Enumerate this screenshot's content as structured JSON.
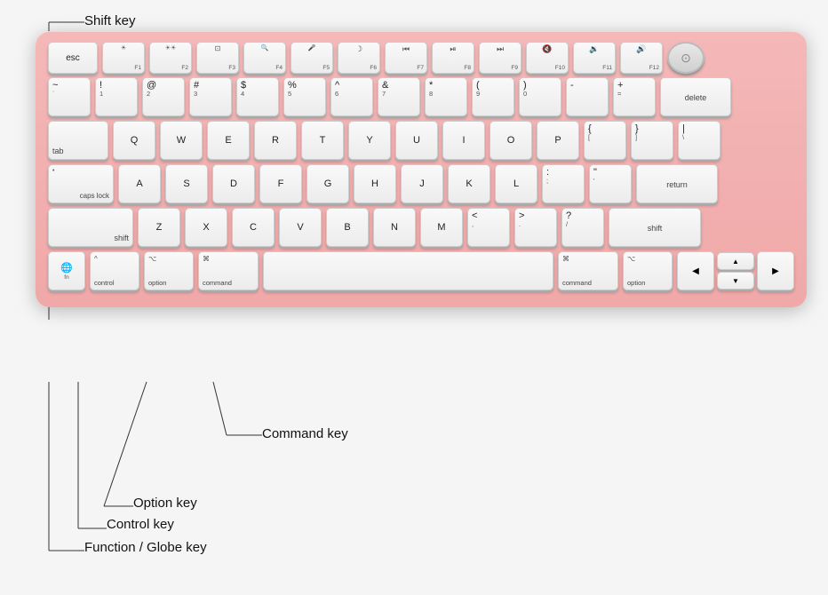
{
  "page": {
    "bg": "#f0f0f0"
  },
  "callouts": {
    "shift_key": "Shift key",
    "command_key": "Command key",
    "option_key": "Option key",
    "control_key": "Control key",
    "function_globe_key": "Function / Globe key"
  },
  "keyboard": {
    "rows": {
      "fn_row": [
        "esc",
        "F1",
        "F2",
        "F3",
        "F4",
        "F5",
        "F6",
        "F7",
        "F8",
        "F9",
        "F10",
        "F11",
        "F12",
        "TouchID"
      ],
      "num_row": [
        "~`",
        "!1",
        "@2",
        "#3",
        "$4",
        "%5",
        "^6",
        "&7",
        "*8",
        "(9",
        ")0",
        "-",
        "=",
        "delete"
      ],
      "qwerty": [
        "tab",
        "Q",
        "W",
        "E",
        "R",
        "T",
        "Y",
        "U",
        "I",
        "O",
        "P",
        "{[",
        "}]",
        "\\|"
      ],
      "home": [
        "caps lock",
        "A",
        "S",
        "D",
        "F",
        "G",
        "H",
        "J",
        "K",
        "L",
        ";:",
        "'\"",
        "return"
      ],
      "shift_row": [
        "shift",
        "Z",
        "X",
        "C",
        "V",
        "B",
        "N",
        "M",
        "<,",
        ">.",
        "?/",
        "shift"
      ],
      "bottom": [
        "fn/globe",
        "control",
        "option",
        "command",
        "space",
        "command",
        "option",
        "arrows"
      ]
    }
  }
}
